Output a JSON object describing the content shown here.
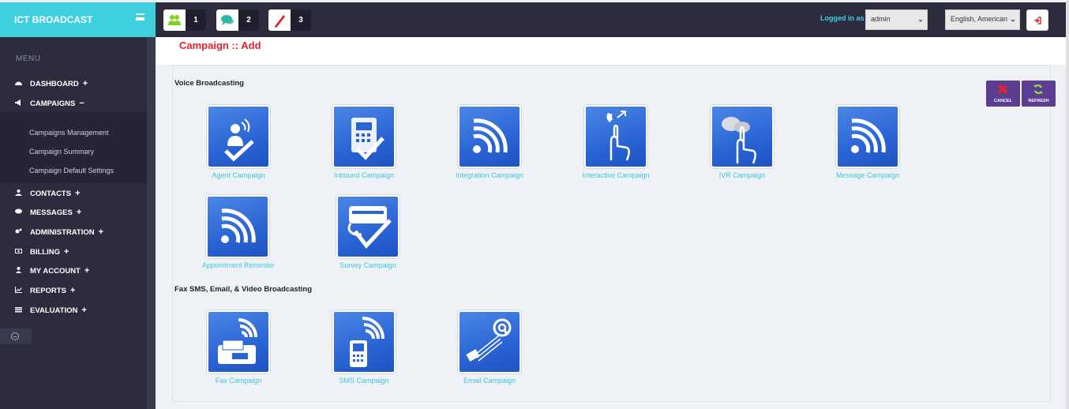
{
  "app": {
    "brand": "ICT BROADCAST"
  },
  "topbar": {
    "notifications": [
      {
        "icon": "users-icon",
        "count": "1",
        "color": "#7ed321"
      },
      {
        "icon": "chat-icon",
        "count": "2",
        "color": "#2fb5a0"
      },
      {
        "icon": "pen-icon",
        "count": "3",
        "color": "#e3222f"
      }
    ],
    "logged_in_label": "Logged in as :",
    "user": "admin",
    "language": "English, American"
  },
  "sidebar": {
    "menu_heading": "MENU",
    "items": [
      {
        "label": "DASHBOARD",
        "toggle": "+"
      },
      {
        "label": "CAMPAIGNS",
        "toggle": "−"
      },
      {
        "label": "CONTACTS",
        "toggle": "+"
      },
      {
        "label": "MESSAGES",
        "toggle": "+"
      },
      {
        "label": "ADMINISTRATION",
        "toggle": "+"
      },
      {
        "label": "BILLING",
        "toggle": "+"
      },
      {
        "label": "MY ACCOUNT",
        "toggle": "+"
      },
      {
        "label": "REPORTS",
        "toggle": "+"
      },
      {
        "label": "EVALUATION",
        "toggle": "+"
      }
    ],
    "campaign_submenu": [
      "Campaigns Management",
      "Campaign Summary",
      "Campaign Default Settings"
    ]
  },
  "page": {
    "title": "Campaign :: Add",
    "sections": [
      "Voice Broadcasting",
      "Fax SMS, Email, & Video Broadcasting"
    ],
    "voice_tiles": [
      {
        "label": "Agent Campaign",
        "icon": "agent-campaign-icon"
      },
      {
        "label": "Inbound Campaign",
        "icon": "inbound-campaign-icon"
      },
      {
        "label": "Integration Campaign",
        "icon": "integration-campaign-icon"
      },
      {
        "label": "Interactive Campaign",
        "icon": "interactive-campaign-icon"
      },
      {
        "label": "IVR Campaign",
        "icon": "ivr-campaign-icon"
      },
      {
        "label": "Message Campaign",
        "icon": "message-campaign-icon"
      },
      {
        "label": "Appointment Reminder",
        "icon": "appointment-reminder-icon"
      },
      {
        "label": "Survey Campaign",
        "icon": "survey-campaign-icon"
      }
    ],
    "fax_tiles": [
      {
        "label": "Fax Campaign",
        "icon": "fax-campaign-icon"
      },
      {
        "label": "SMS Campaign",
        "icon": "sms-campaign-icon"
      },
      {
        "label": "Email Campaign",
        "icon": "email-campaign-icon"
      }
    ],
    "actions": {
      "cancel": "CANCEL",
      "refresh": "REFRESH"
    }
  }
}
